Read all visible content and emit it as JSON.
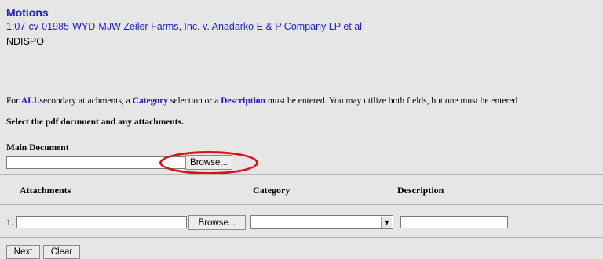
{
  "header": {
    "title": "Motions",
    "case_link": "1:07-cv-01985-WYD-MJW Zeiler Farms, Inc. v. Anadarko E & P Company LP et al",
    "event_code": "NDISPO"
  },
  "instruction": {
    "prefix": "For ",
    "all": "ALL",
    "part1": "secondary attachments, a ",
    "category": "Category",
    "part2": " selection or a ",
    "description": "Description",
    "part3": " must be entered. You may utilize both fields, but one must be entered"
  },
  "select_prompt": "Select the pdf document and any attachments.",
  "main_document": {
    "label": "Main Document",
    "value": "",
    "browse_label": "Browse..."
  },
  "attachments": {
    "columns": [
      "Attachments",
      "Category",
      "Description"
    ],
    "rows": [
      {
        "number": "1.",
        "file_value": "",
        "browse_label": "Browse...",
        "category_selected": "",
        "description_value": ""
      }
    ]
  },
  "buttons": {
    "next": "Next",
    "clear": "Clear"
  },
  "colors": {
    "link": "#1c1cd6",
    "highlight": "#e01010",
    "panel": "#e6e6e6"
  }
}
